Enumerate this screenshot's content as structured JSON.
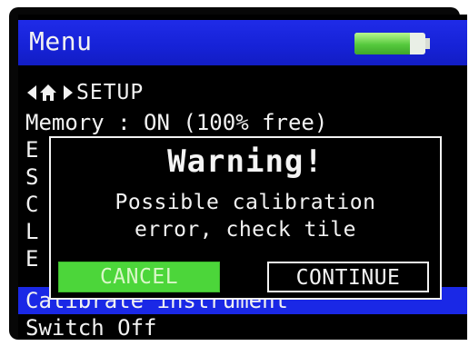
{
  "header": {
    "title": "Menu",
    "battery_level": 0.78,
    "battery_icon": "battery-icon"
  },
  "breadcrumb": {
    "back_icon": "left-arrow-icon",
    "home_icon": "home-icon",
    "forward_icon": "right-arrow-icon",
    "label": "SETUP"
  },
  "menu": {
    "items": [
      {
        "label": "Memory : ON  (100% free)",
        "selected": false
      },
      {
        "label": "E",
        "selected": false
      },
      {
        "label": "S",
        "selected": false
      },
      {
        "label": "C",
        "selected": false
      },
      {
        "label": "L",
        "selected": false
      },
      {
        "label": "E",
        "selected": false
      },
      {
        "label": "Calibrate instrument",
        "selected": true
      },
      {
        "label": "Switch Off",
        "selected": false
      }
    ]
  },
  "dialog": {
    "title": "Warning!",
    "message_line1": "Possible calibration",
    "message_line2": "error, check tile",
    "cancel_label": "CANCEL",
    "continue_label": "CONTINUE"
  },
  "colors": {
    "title_bar": "#1622d6",
    "selected_row": "#1a28e6",
    "cancel_button": "#4cd63a",
    "battery_fill": "#55c93d",
    "screen_bg": "#000000",
    "text": "#f2f2f2"
  }
}
